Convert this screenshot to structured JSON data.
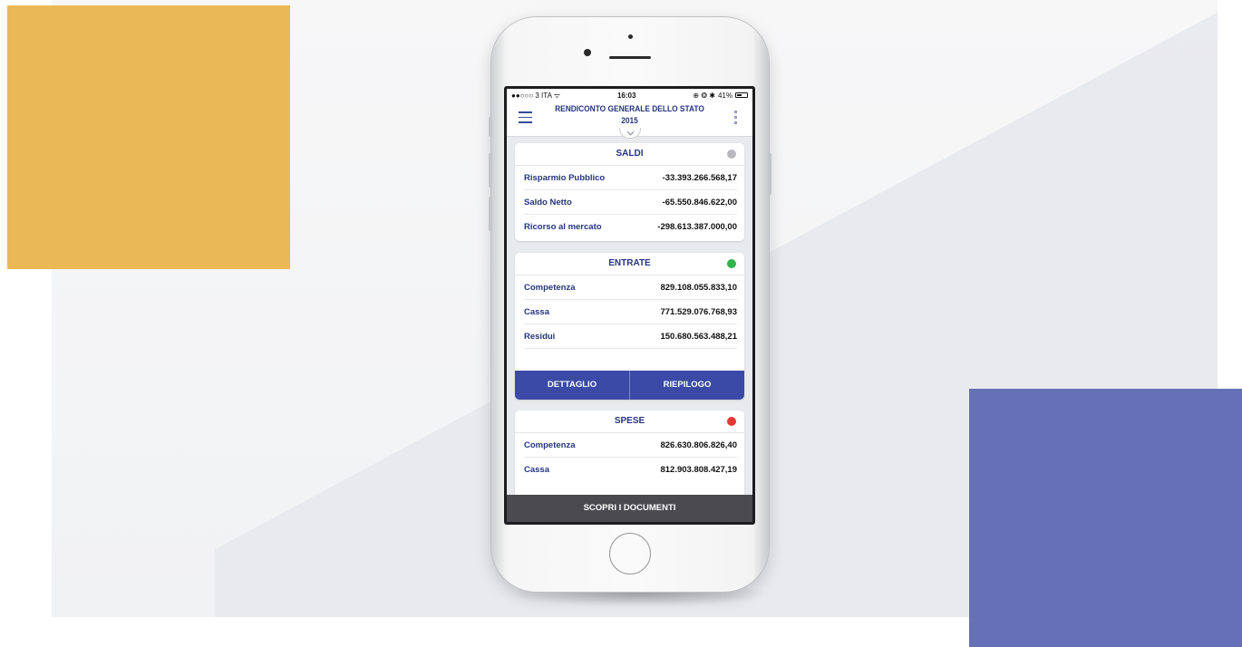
{
  "colors": {
    "deco_yellow": "#eab955",
    "deco_blue": "#6570b6",
    "accent": "#25347f",
    "button": "#3a4aa6",
    "status_neutral": "#b9b9bd",
    "status_good": "#2fb34a",
    "status_bad": "#e53935"
  },
  "statusbar": {
    "carrier": "●●○○○ 3 ITA ᯤ",
    "time": "16:03",
    "battery": "41%"
  },
  "header": {
    "title_line1": "RENDICONTO GENERALE DELLO STATO",
    "title_line2": "2015",
    "menu_icon": "hamburger-icon",
    "more_icon": "kebab-icon"
  },
  "saldi": {
    "title": "SALDI",
    "status": "neutral",
    "rows": [
      {
        "label": "Risparmio Pubblico",
        "value": "-33.393.266.568,17"
      },
      {
        "label": "Saldo Netto",
        "value": "-65.550.846.622,00"
      },
      {
        "label": "Ricorso al mercato",
        "value": "-298.613.387.000,00"
      }
    ]
  },
  "entrate": {
    "title": "ENTRATE",
    "status": "good",
    "rows": [
      {
        "label": "Competenza",
        "value": "829.108.055.833,10"
      },
      {
        "label": "Cassa",
        "value": "771.529.076.768,93"
      },
      {
        "label": "Residui",
        "value": "150.680.563.488,21"
      }
    ],
    "buttons": {
      "dettaglio": "DETTAGLIO",
      "riepilogo": "RIEPILOGO"
    }
  },
  "spese": {
    "title": "SPESE",
    "status": "bad",
    "rows": [
      {
        "label": "Competenza",
        "value": "826.630.806.826,40"
      },
      {
        "label": "Cassa",
        "value": "812.903.808.427,19"
      }
    ]
  },
  "footer": {
    "label": "SCOPRI I DOCUMENTI"
  }
}
